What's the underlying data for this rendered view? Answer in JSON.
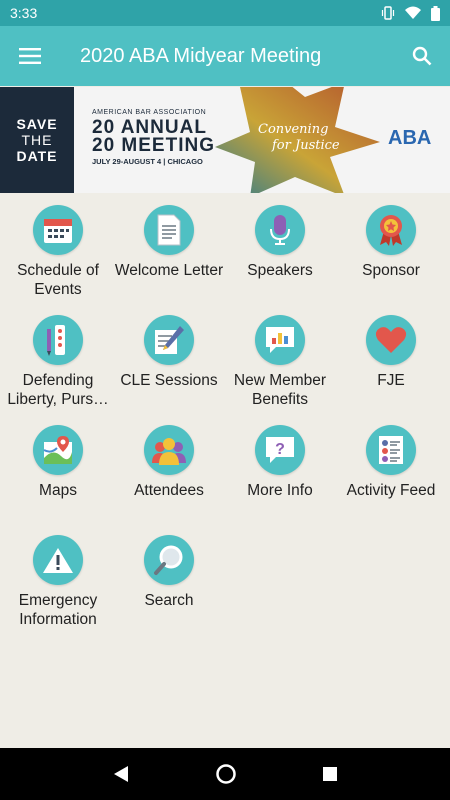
{
  "status_bar": {
    "time": "3:33"
  },
  "app_bar": {
    "title": "2020 ABA Midyear Meeting"
  },
  "banner": {
    "save_line1": "SAVE",
    "save_line2": "THE",
    "save_line3": "DATE",
    "org": "AMERICAN BAR ASSOCIATION",
    "title_line1": "20 ANNUAL",
    "title_line2": "20 MEETING",
    "dates": "JULY 29-AUGUST 4 | CHICAGO",
    "tagline_line1": "Convening",
    "tagline_line2": "for Justice",
    "logo": "ABA"
  },
  "tiles": [
    {
      "label": "Schedule of Events",
      "icon": "calendar-icon"
    },
    {
      "label": "Welcome Letter",
      "icon": "document-icon"
    },
    {
      "label": "Speakers",
      "icon": "microphone-icon"
    },
    {
      "label": "Sponsor",
      "icon": "award-ribbon-icon"
    },
    {
      "label": "Defending Liberty, Purs…",
      "icon": "pencil-list-icon"
    },
    {
      "label": "CLE Sessions",
      "icon": "notepad-pencil-icon"
    },
    {
      "label": "New Member Benefits",
      "icon": "chart-bubble-icon"
    },
    {
      "label": "FJE",
      "icon": "heart-icon"
    },
    {
      "label": "Maps",
      "icon": "map-pin-icon"
    },
    {
      "label": "Attendees",
      "icon": "people-icon"
    },
    {
      "label": "More Info",
      "icon": "question-icon"
    },
    {
      "label": "Activity Feed",
      "icon": "feed-list-icon"
    },
    {
      "label": "Emergency Information",
      "icon": "warning-icon"
    },
    {
      "label": "Search",
      "icon": "magnifier-icon"
    }
  ]
}
